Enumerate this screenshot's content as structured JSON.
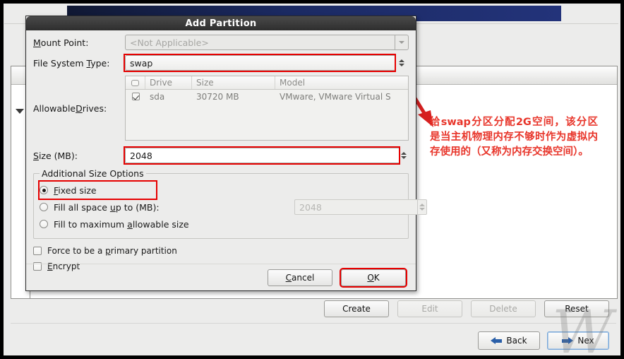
{
  "background": {
    "drive_buttons": [
      {
        "label": "Create",
        "accel": "C",
        "disabled": false
      },
      {
        "label": "Edit",
        "accel": "E",
        "disabled": true
      },
      {
        "label": "Delete",
        "accel": "D",
        "disabled": true
      },
      {
        "label": "Reset",
        "accel": "s",
        "disabled": false
      }
    ],
    "nav_buttons": [
      {
        "label": "Back",
        "accel": "B",
        "icon": "arrow-left-icon"
      },
      {
        "label": "Nex",
        "accel": "N",
        "icon": "arrow-right-icon"
      }
    ],
    "watermark": "W"
  },
  "dialog": {
    "title": "Add Partition",
    "mount_point": {
      "label": "Mount Point:",
      "value": "<Not Applicable>",
      "icon": "chevron-down-icon",
      "disabled": true
    },
    "file_system_type": {
      "label": "File System Type:",
      "value": "swap",
      "icon": "spinner-updown-icon",
      "highlighted": true
    },
    "allowable_drives": {
      "label": "Allowable Drives:",
      "columns": [
        "O",
        "Drive",
        "Size",
        "Model"
      ],
      "rows": [
        {
          "checked": true,
          "drive": "sda",
          "size": "30720 MB",
          "model": "VMware, VMware Virtual S"
        }
      ]
    },
    "size": {
      "label": "Size (MB):",
      "value": "2048",
      "highlighted": true
    },
    "additional_size_options": {
      "legend": "Additional Size Options",
      "options": [
        {
          "label": "Fixed size",
          "selected": true,
          "highlighted": true
        },
        {
          "label": "Fill all space up to (MB):",
          "selected": false,
          "field_value": "2048",
          "field_disabled": true
        },
        {
          "label": "Fill to maximum allowable size",
          "selected": false
        }
      ]
    },
    "checkboxes": [
      {
        "label": "Force to be a primary partition",
        "checked": false
      },
      {
        "label": "Encrypt",
        "checked": false
      }
    ],
    "buttons": [
      {
        "label": "Cancel",
        "accel": "C",
        "highlighted": false
      },
      {
        "label": "OK",
        "accel": "O",
        "highlighted": true
      }
    ]
  },
  "annotation": {
    "text": "给swap分区分配2G空间，该分区是当主机物理内存不够时作为虚拟内存使用的（又称为内存交换空间）。",
    "color": "#e8352a",
    "arrow": "red-arrow-icon"
  }
}
